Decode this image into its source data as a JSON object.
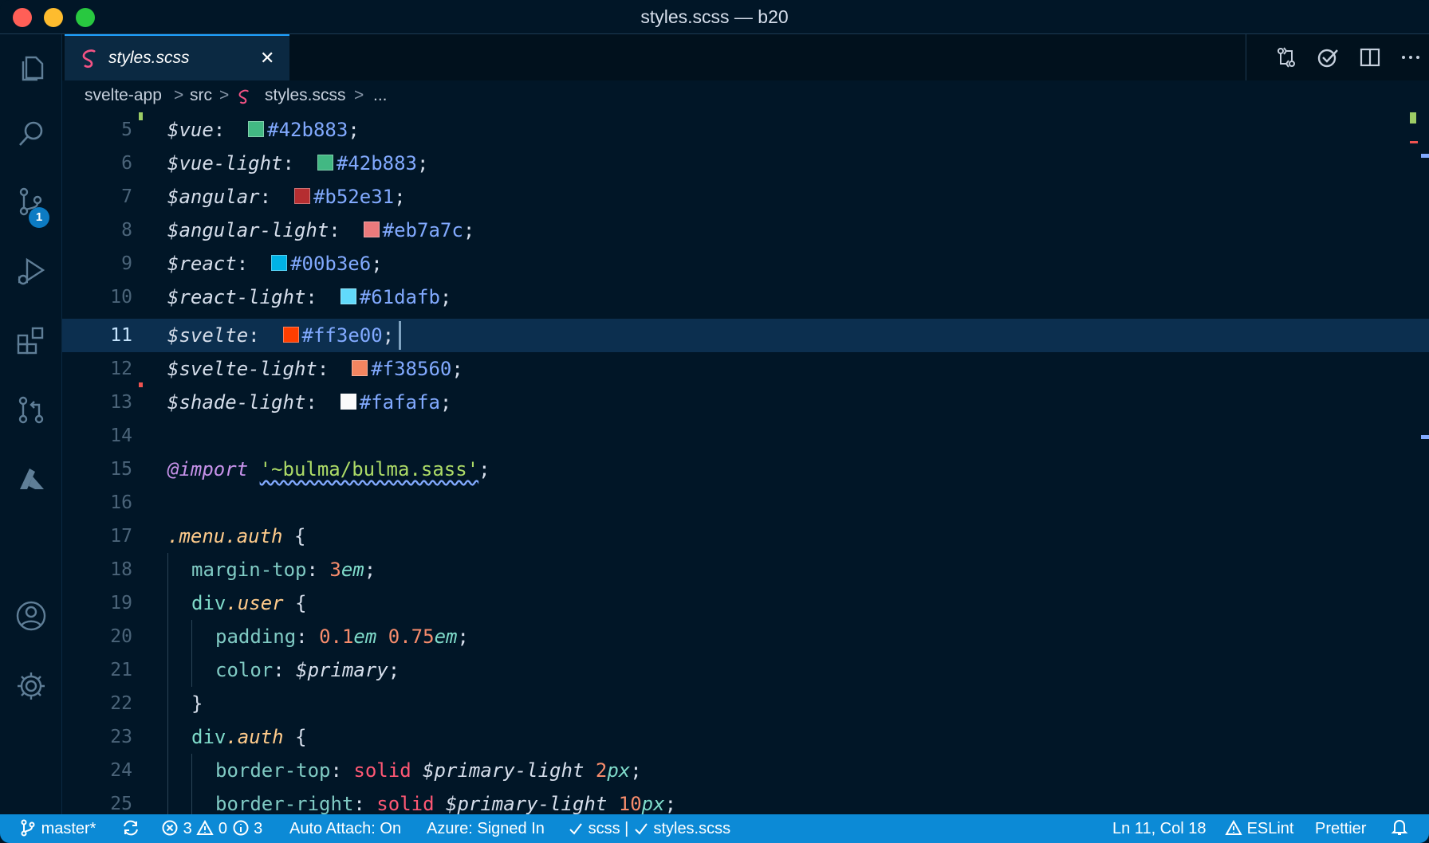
{
  "window": {
    "title": "styles.scss — b20"
  },
  "activity_bar": {
    "items": [
      {
        "name": "explorer",
        "icon": "files-icon"
      },
      {
        "name": "search",
        "icon": "search-icon"
      },
      {
        "name": "source-control",
        "icon": "source-control-icon",
        "badge": "1"
      },
      {
        "name": "run-debug",
        "icon": "run-debug-icon"
      },
      {
        "name": "extensions",
        "icon": "extensions-icon"
      },
      {
        "name": "pull-requests",
        "icon": "pull-request-icon"
      },
      {
        "name": "azure",
        "icon": "azure-icon"
      }
    ],
    "bottom": [
      {
        "name": "accounts",
        "icon": "account-icon"
      },
      {
        "name": "manage",
        "icon": "gear-icon"
      }
    ]
  },
  "tabs": [
    {
      "label": "styles.scss",
      "active": true,
      "close": "✕"
    }
  ],
  "editor_actions": [
    "compare-changes-icon",
    "check-icon",
    "split-editor-icon",
    "more-actions-icon"
  ],
  "breadcrumbs": {
    "items": [
      "svelte-app",
      "src",
      "styles.scss",
      "..."
    ],
    "separator": ">"
  },
  "editor": {
    "lines": [
      {
        "n": "5",
        "var": "$vue",
        "color": "#42b883"
      },
      {
        "n": "6",
        "var": "$vue-light",
        "color": "#42b883"
      },
      {
        "n": "7",
        "var": "$angular",
        "color": "#b52e31"
      },
      {
        "n": "8",
        "var": "$angular-light",
        "color": "#eb7a7c"
      },
      {
        "n": "9",
        "var": "$react",
        "color": "#00b3e6"
      },
      {
        "n": "10",
        "var": "$react-light",
        "color": "#61dafb"
      },
      {
        "n": "11",
        "var": "$svelte",
        "color": "#ff3e00"
      },
      {
        "n": "12",
        "var": "$svelte-light",
        "color": "#f38560"
      },
      {
        "n": "13",
        "var": "$shade-light",
        "color": "#fafafa"
      },
      {
        "n": "14"
      },
      {
        "n": "15",
        "import_kw": "@import",
        "import_path": "'~bulma/bulma.sass'"
      },
      {
        "n": "16"
      },
      {
        "n": "17",
        "selector": ".menu.auth",
        "brace": "{"
      },
      {
        "n": "18",
        "prop": "margin-top",
        "num": "3",
        "unit": "em"
      },
      {
        "n": "19",
        "tag": "div",
        "cls": ".user",
        "brace": "{"
      },
      {
        "n": "20",
        "prop": "padding",
        "num1": "0.1",
        "unit1": "em",
        "num2": "0.75",
        "unit2": "em"
      },
      {
        "n": "21",
        "prop": "color",
        "value": "$primary"
      },
      {
        "n": "22",
        "brace": "}"
      },
      {
        "n": "23",
        "tag": "div",
        "cls": ".auth",
        "brace": "{"
      },
      {
        "n": "24",
        "prop": "border-top",
        "kw": "solid",
        "value": "$primary-light",
        "num": "2",
        "unit": "px"
      },
      {
        "n": "25",
        "prop": "border-right",
        "kw": "solid",
        "value": "$primary-light",
        "num": "10",
        "unit": "px"
      }
    ],
    "current_line": "11"
  },
  "status_bar": {
    "branch": "master*",
    "errors": "3",
    "warnings": "0",
    "infos": "3",
    "auto_attach": "Auto Attach: On",
    "azure": "Azure: Signed In",
    "lang_check": "scss | ",
    "file_check": "styles.scss",
    "position": "Ln 11, Col 18",
    "eslint": "ESLint",
    "prettier": "Prettier"
  }
}
